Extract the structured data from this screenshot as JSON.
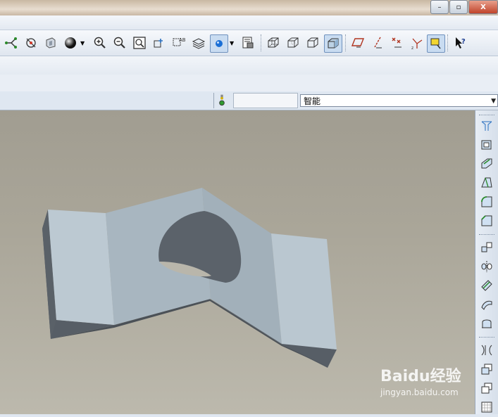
{
  "window": {
    "minimize_glyph": "–",
    "maximize_glyph": "▫",
    "close_glyph": "X"
  },
  "toolbar": {
    "icons": [
      "datum-display-icon",
      "spin-center-icon",
      "saved-views-icon",
      "shading-icon",
      "zoom-in-icon",
      "zoom-out-icon",
      "refit-icon",
      "reorient-icon",
      "annotation-display-icon",
      "layers-icon",
      "appearance-icon",
      "view-manager-icon",
      "wireframe-icon",
      "hidden-line-icon",
      "no-hidden-icon",
      "shaded-icon",
      "datum-planes-icon",
      "datum-axes-icon",
      "datum-points-icon",
      "coordinate-systems-icon",
      "spin-center-toggle-icon",
      "context-help-icon"
    ]
  },
  "filter": {
    "selection_filter_value": "智能"
  },
  "rightbar": {
    "icons": [
      "hole-icon",
      "shell-icon",
      "rib-icon",
      "draft-icon",
      "round-icon",
      "chamfer-icon",
      "pattern-icon",
      "mirror-icon",
      "merge-icon",
      "trim-icon",
      "extend-icon",
      "offset-icon",
      "intersect-icon",
      "solidify-icon",
      "thicken-icon"
    ]
  },
  "watermark": {
    "logo": "Baidu经验",
    "url": "jingyan.baidu.com"
  }
}
